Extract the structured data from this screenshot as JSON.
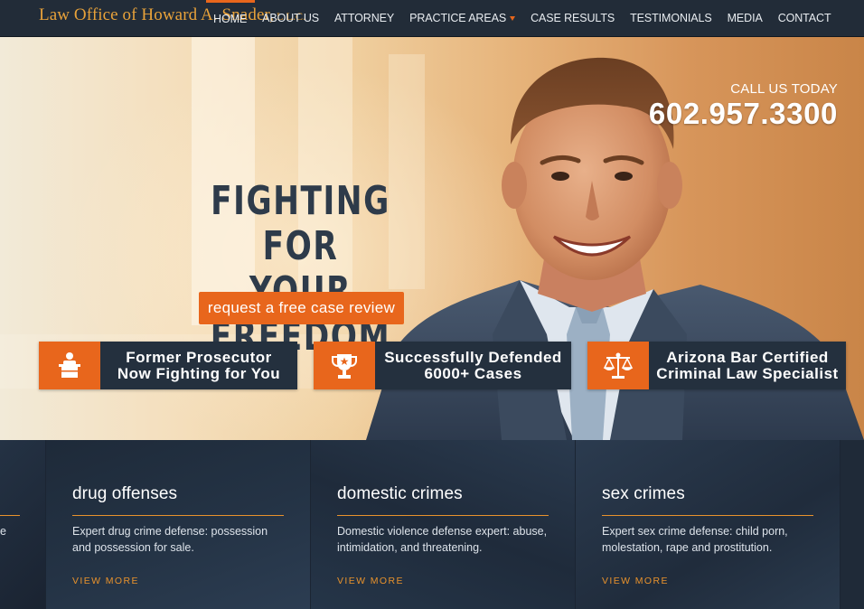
{
  "logo": {
    "name": "Law Office of Howard A. Snader,",
    "suffix": "L.L.C."
  },
  "nav": {
    "items": [
      {
        "label": "HOME"
      },
      {
        "label": "ABOUT US"
      },
      {
        "label": "ATTORNEY"
      },
      {
        "label": "PRACTICE AREAS"
      },
      {
        "label": "CASE RESULTS"
      },
      {
        "label": "TESTIMONIALS"
      },
      {
        "label": "MEDIA"
      },
      {
        "label": "CONTACT"
      }
    ]
  },
  "hero": {
    "call_label": "CALL US TODAY",
    "phone": "602.957.3300",
    "headline_line1": "FIGHTING FOR",
    "headline_line2": "YOUR FREEDOM",
    "cta": "request a free case review"
  },
  "badges": [
    {
      "icon": "podium-icon",
      "line1": "Former Prosecutor",
      "line2": "Now Fighting for You"
    },
    {
      "icon": "trophy-icon",
      "line1": "Successfully Defended",
      "line2": "6000+ Cases"
    },
    {
      "icon": "scales-icon",
      "line1": "Arizona Bar Certified",
      "line2": "Criminal Law Specialist"
    }
  ],
  "practice": [
    {
      "partial_desc": "e"
    },
    {
      "title": "drug offenses",
      "desc": "Expert drug crime defense: possession and possession for sale.",
      "more": "VIEW MORE"
    },
    {
      "title": "domestic crimes",
      "desc": "Domestic violence defense expert: abuse, intimidation, and threatening.",
      "more": "VIEW MORE"
    },
    {
      "title": "sex crimes",
      "desc": "Expert sex crime defense: child porn, molestation, rape and prostitution.",
      "more": "VIEW MORE"
    }
  ],
  "colors": {
    "accent": "#e8661c",
    "navy": "#24303e",
    "gold": "#e8a23a"
  }
}
